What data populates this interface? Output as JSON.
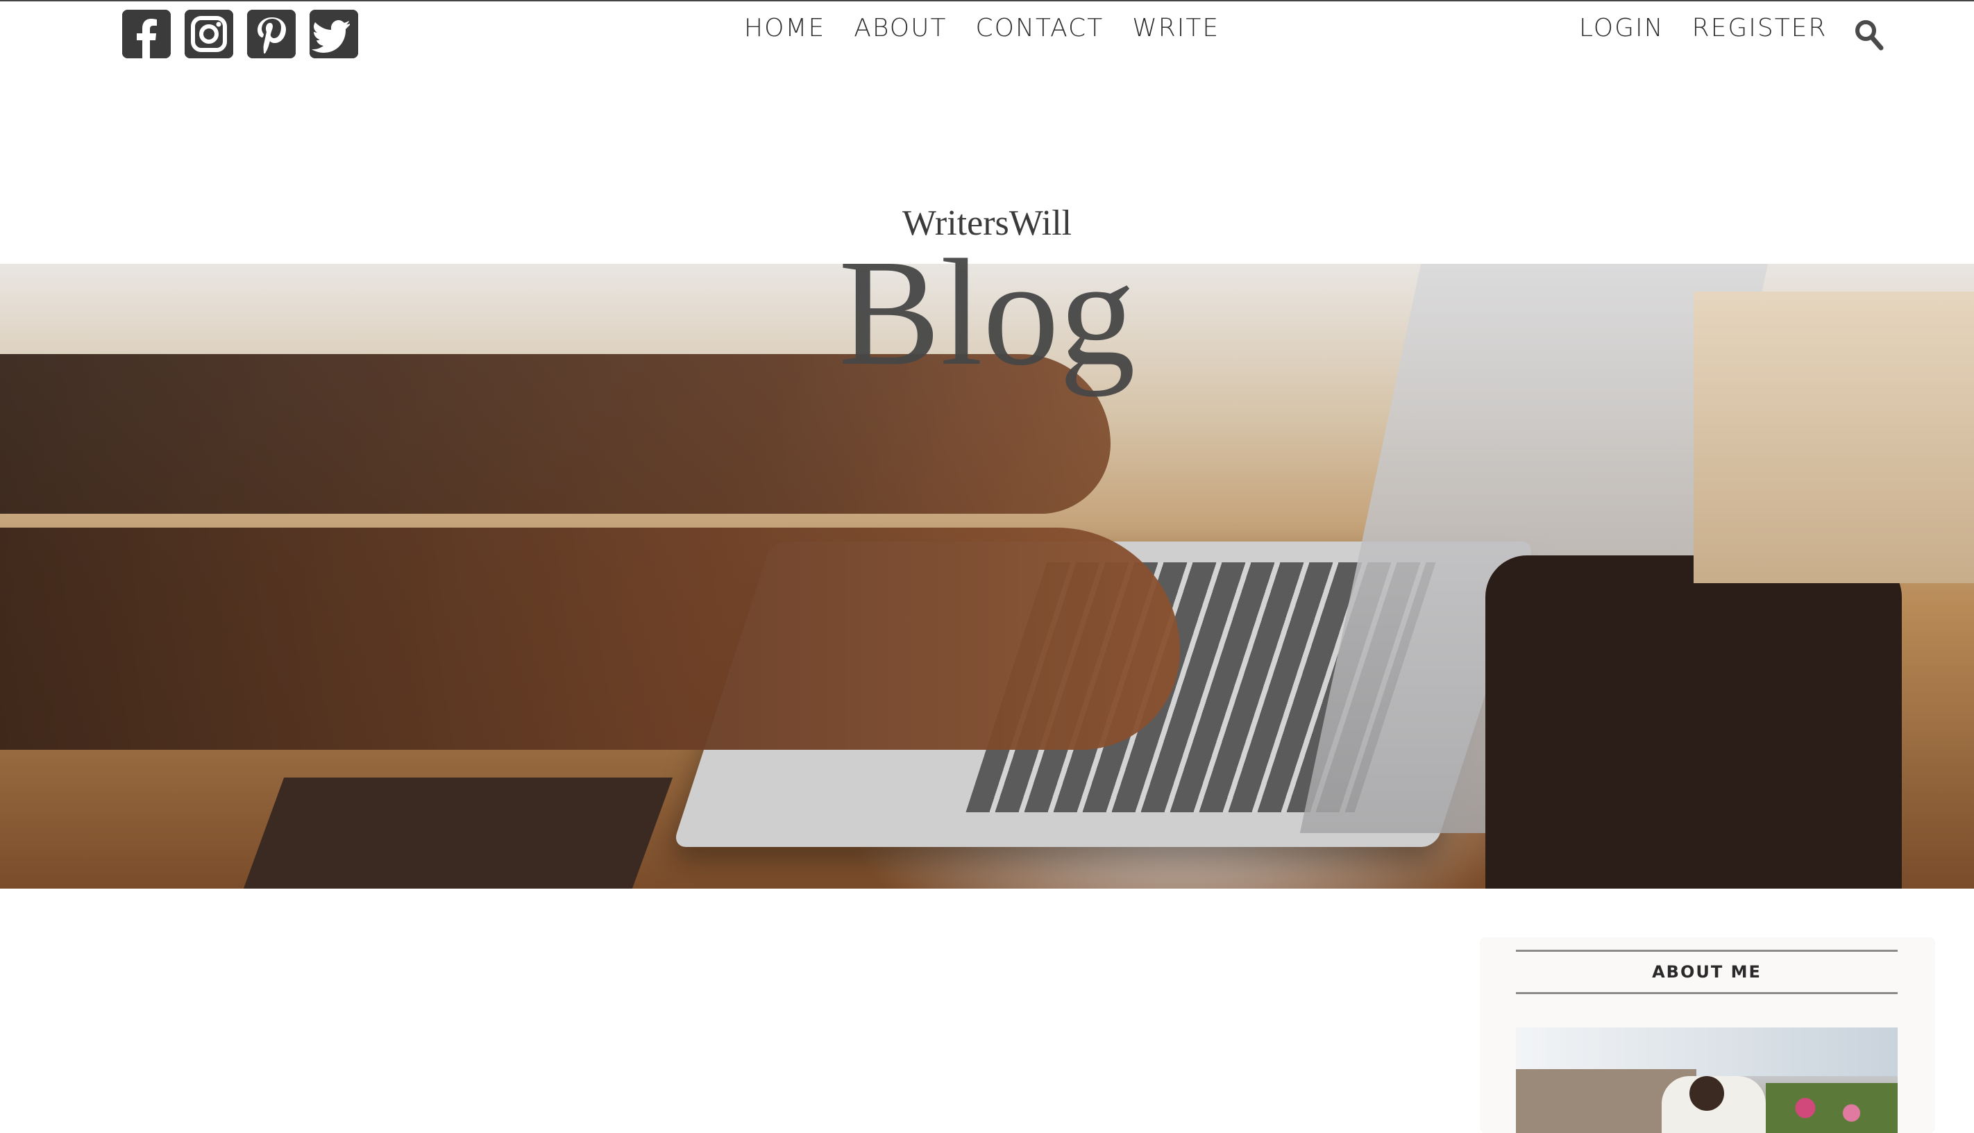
{
  "social": {
    "items": [
      {
        "name": "facebook",
        "icon": "facebook-icon"
      },
      {
        "name": "instagram",
        "icon": "instagram-icon"
      },
      {
        "name": "pinterest",
        "icon": "pinterest-icon"
      },
      {
        "name": "twitter",
        "icon": "twitter-icon"
      }
    ],
    "icon_color": "#3b3b3b"
  },
  "nav": {
    "home": "HOME",
    "about": "ABOUT",
    "contact": "CONTACT",
    "write": "WRITE"
  },
  "auth": {
    "login": "LOGIN",
    "register": "REGISTER"
  },
  "search": {
    "icon": "search-icon"
  },
  "brand": {
    "small": "WritersWill",
    "big": "Blog"
  },
  "sidebar": {
    "about_title": "ABOUT ME"
  }
}
